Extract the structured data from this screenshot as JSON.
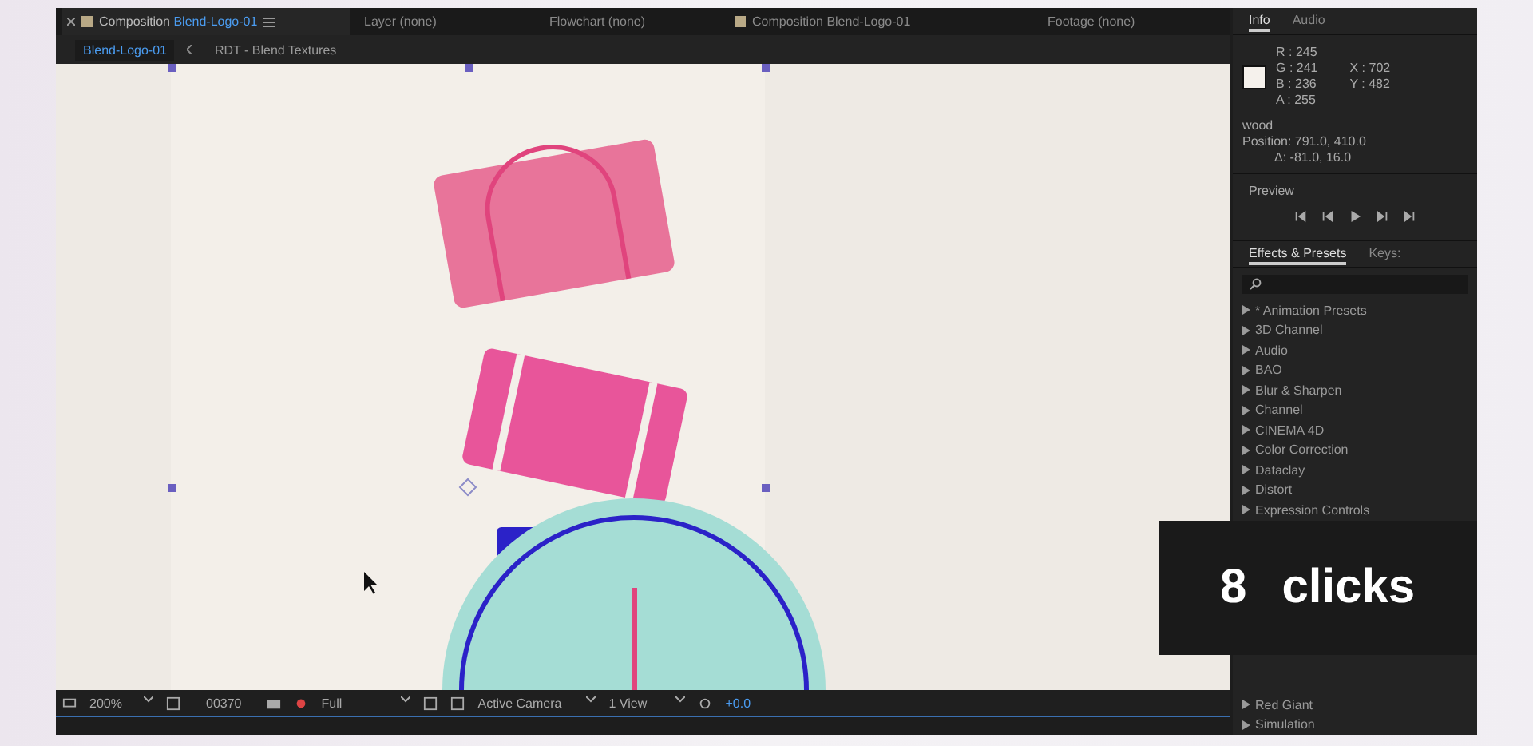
{
  "panel_tabs": [
    {
      "prefix": "Composition",
      "name": "Blend-Logo-01",
      "swatch": true,
      "selected": true
    },
    {
      "prefix": "Layer (none)",
      "swatch": false,
      "selected": false
    },
    {
      "prefix": "Flowchart (none)",
      "swatch": false,
      "selected": false
    },
    {
      "prefix": "Composition Blend-Logo-01",
      "swatch": true,
      "selected": false
    },
    {
      "prefix": "Footage (none)",
      "swatch": false,
      "selected": false
    }
  ],
  "breadcrumbs": [
    {
      "label": "Blend-Logo-01",
      "selected": true
    },
    {
      "label": "RDT - Blend Textures",
      "selected": false
    }
  ],
  "viewer_toolbar": {
    "zoom": "200%",
    "timecode": "00370",
    "resolution": "Full",
    "camera": "Active Camera",
    "views": "1 View",
    "exposure": "+0.0"
  },
  "info": {
    "tabs": [
      {
        "label": "Info",
        "selected": true
      },
      {
        "label": "Audio",
        "selected": false
      }
    ],
    "rgba": [
      "R : 245",
      "G : 241",
      "B : 236",
      "A : 255"
    ],
    "coords": [
      "X : 702",
      "Y : 482"
    ],
    "layer": "wood",
    "position": "Position: 791.0, 410.0",
    "delta": "Δ: -81.0, 16.0"
  },
  "preview": {
    "title": "Preview"
  },
  "effects": {
    "tabs": [
      {
        "label": "Effects & Presets",
        "selected": true
      },
      {
        "label": "Keys:",
        "selected": false
      }
    ],
    "items": [
      "* Animation Presets",
      "3D Channel",
      "Audio",
      "BAO",
      "Blur & Sharpen",
      "Channel",
      "CINEMA 4D",
      "Color Correction",
      "Dataclay",
      "Distort",
      "Expression Controls"
    ],
    "items_below": [
      "Red Giant",
      "Simulation"
    ]
  },
  "overlay": {
    "count": "8",
    "word": "clicks"
  }
}
